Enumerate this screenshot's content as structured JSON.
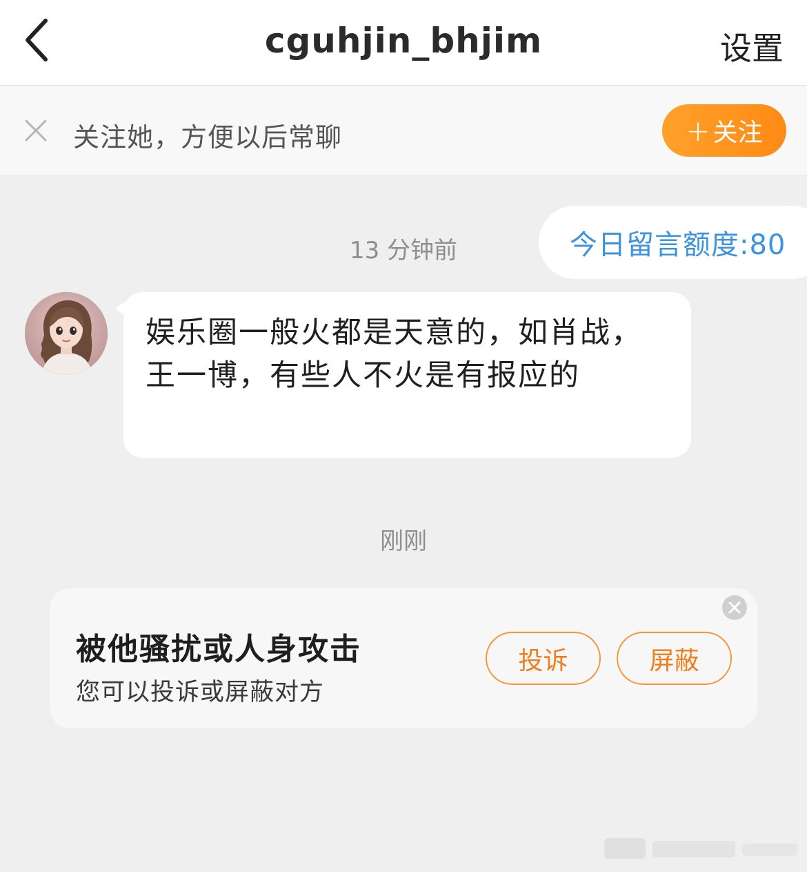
{
  "navbar": {
    "title": "cguhjin_bhjim",
    "settings_label": "设置",
    "back_icon": "chevron-left-icon"
  },
  "follow_bar": {
    "prompt_text": "关注她，方便以后常聊",
    "follow_button_label": "关注",
    "follow_button_plus": "+",
    "close_icon": "close-icon",
    "accent_color": "#ff8f1c"
  },
  "chat": {
    "quota_text": "今日留言额度:80",
    "quota_color": "#3d93dd",
    "timestamp_1": "13 分钟前",
    "timestamp_2": "刚刚",
    "messages": [
      {
        "sender": "other",
        "text": "娱乐圈一般火都是天意的，如肖战，王一博，有些人不火是有报应的"
      }
    ]
  },
  "safety_card": {
    "title": "被他骚扰或人身攻击",
    "subtitle": "您可以投诉或屏蔽对方",
    "report_label": "投诉",
    "block_label": "屏蔽",
    "close_icon": "close-circle-icon",
    "button_color": "#f07d1e"
  }
}
